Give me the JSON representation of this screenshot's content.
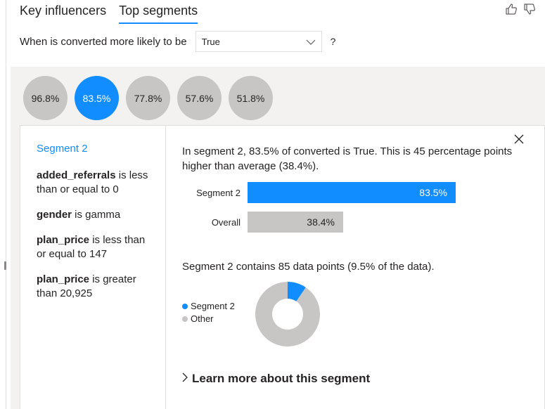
{
  "tabs": [
    {
      "label": "Key influencers",
      "active": false
    },
    {
      "label": "Top segments",
      "active": true
    }
  ],
  "feedback": {
    "icons": [
      "thumbs-up-icon",
      "thumbs-down-icon"
    ]
  },
  "question": {
    "prefix": "When is converted more likely to be",
    "selected_value": "True",
    "suffix": "?"
  },
  "segments": [
    "96.8%",
    "83.5%",
    "77.8%",
    "57.6%",
    "51.8%"
  ],
  "selected_segment_index": 1,
  "detail": {
    "title": "Segment 2",
    "conditions": [
      {
        "field": "added_referrals",
        "text": " is less than or equal to 0"
      },
      {
        "field": "gender",
        "text": " is gamma"
      },
      {
        "field": "plan_price",
        "text": " is less than or equal to 147"
      },
      {
        "field": "plan_price",
        "text": " is greater than 20,925"
      }
    ],
    "description": "In segment 2, 83.5% of converted is True. This is 45 percentage points higher than average (38.4%).",
    "contains": "Segment 2 contains 85 data points (9.5% of the data).",
    "learn_more": "Learn more about this segment"
  },
  "chart_data": {
    "type": "bar",
    "categories": [
      "Segment 2",
      "Overall"
    ],
    "values": [
      83.5,
      38.4
    ],
    "value_labels": [
      "83.5%",
      "38.4%"
    ],
    "colors": [
      "#118dff",
      "#c8c6c4"
    ]
  },
  "donut": {
    "type": "pie",
    "series": [
      {
        "name": "Segment 2",
        "value": 9.5,
        "color": "#118dff"
      },
      {
        "name": "Other",
        "value": 90.5,
        "color": "#c8c6c4"
      }
    ]
  },
  "colors": {
    "accent": "#118dff",
    "neutral": "#c8c6c4",
    "panel": "#f3f2f1"
  }
}
